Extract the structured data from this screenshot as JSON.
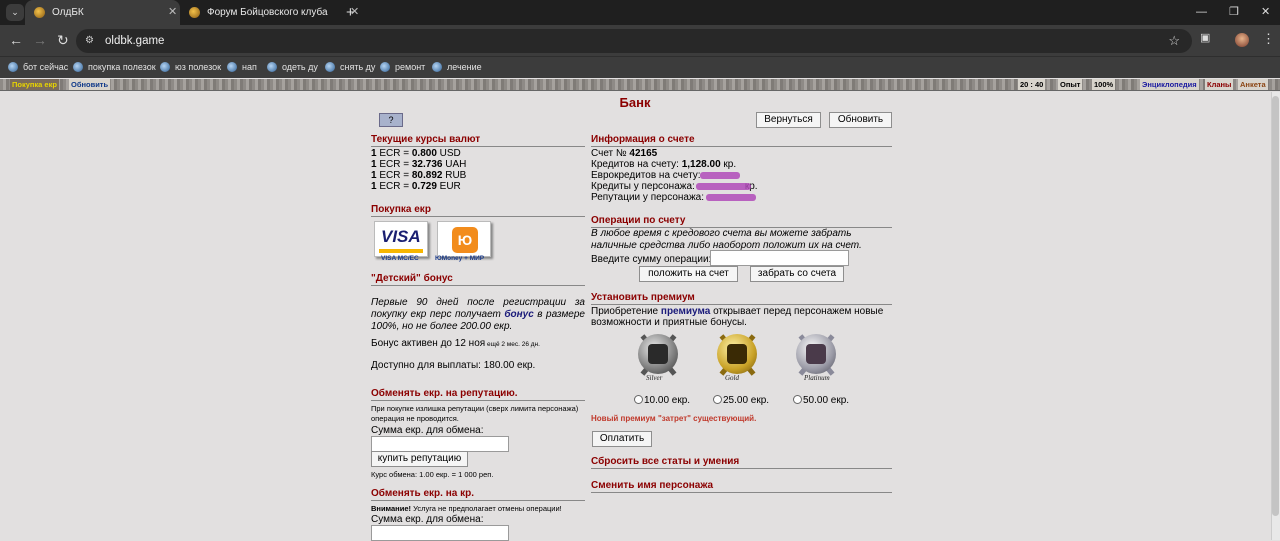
{
  "browser": {
    "tabs": [
      {
        "title": "ОлдБК",
        "active": true
      },
      {
        "title": "Форум Бойцовского клуба",
        "active": false
      }
    ],
    "url": "oldbk.game",
    "bookmarks": [
      "бот сейчас",
      "покупка полезок",
      "юз полезок",
      "нап",
      "одеть ду",
      "снять ду",
      "ремонт",
      "лечение"
    ]
  },
  "gamebar": {
    "left": {
      "buy": "Покупка екр",
      "refresh": "Обновить"
    },
    "time": "20 : 40",
    "exp": "Опыт",
    "percent": "100%",
    "right": {
      "encyclopedia": "Энциклопедия",
      "clans": "Кланы",
      "anketa": "Анкета"
    }
  },
  "page": {
    "title": "Банк",
    "help": "?",
    "back_button": "Вернуться",
    "refresh_button": "Обновить"
  },
  "rates": {
    "title": "Текущие курсы валют",
    "lines": [
      {
        "a": "1",
        "b": " ECR = ",
        "c": "0.800",
        "d": " USD"
      },
      {
        "a": "1",
        "b": " ECR = ",
        "c": "32.736",
        "d": " UAH"
      },
      {
        "a": "1",
        "b": " ECR = ",
        "c": "80.892",
        "d": " RUB"
      },
      {
        "a": "1",
        "b": " ECR = ",
        "c": "0.729",
        "d": " EUR"
      }
    ]
  },
  "purchase": {
    "title": "Покупка екр",
    "visa_logo": "VISA",
    "visa_label": "VISA MC/EC",
    "yu_logo": "Ю",
    "yu_label": "ЮMoney + МИР"
  },
  "kids_bonus": {
    "title": "\"Детский\" бонус",
    "text_pre": "Первые 90 дней после регистрации за покупку екр перс получает ",
    "text_bold": "бонус",
    "text_post": " в размере 100%, но не более 200.00 екр.",
    "active_main": "Бонус активен до 12 ноя",
    "active_small": " ещё 2 мес. 26 дн.",
    "available": "Доступно для выплаты: 180.00 екр."
  },
  "rep_exchange": {
    "title": "Обменять екр. на репутацию.",
    "note": "При покупке излишка репутации (сверх лимита персонажа) операция не проводится.",
    "label": "Сумма екр. для обмена:",
    "button": "купить репутацию",
    "rate": "Курс обмена: 1.00 екр. = 1 000 реп."
  },
  "kr_exchange": {
    "title": "Обменять екр. на кр.",
    "warn_bold": "Внимание!",
    "warn_text": " Услуга не предполагает отмены операции!",
    "label": "Сумма екр. для обмена:"
  },
  "account": {
    "title": "Информация о счете",
    "number_label": "Счет № ",
    "number": "42165",
    "credits_label": "Кредитов на счету: ",
    "credits": "1,128.00",
    "credits_unit": " кр.",
    "euro_label": "Еврокредитов на счету:",
    "pers_credits_label": "Кредиты у персонажа:",
    "pers_credits_unit": "кр.",
    "rep_label": "Репутации у персонажа:"
  },
  "operations": {
    "title": "Операции по счету",
    "note": "В любое время с кредового счета вы можете забрать наличные средства либо наоборот положит их на счет.",
    "label": "Введите сумму операции:",
    "deposit": "положить на счет",
    "withdraw": "забрать со счета"
  },
  "premium": {
    "title": "Установить премиум",
    "text_pre": "Приобретение ",
    "text_bold": "премиума",
    "text_post": " открывает перед персонажем новые возможности и приятные бонусы.",
    "options": [
      {
        "name": "Silver",
        "price": "10.00 екр."
      },
      {
        "name": "Gold",
        "price": "25.00 екр."
      },
      {
        "name": "Platinum",
        "price": "50.00 екр."
      }
    ],
    "warning": "Новый премиум \"затрет\" существующий.",
    "pay": "Оплатить"
  },
  "reset": {
    "title": "Сбросить все статы и умения"
  },
  "rename": {
    "title": "Сменить имя персонажа"
  }
}
